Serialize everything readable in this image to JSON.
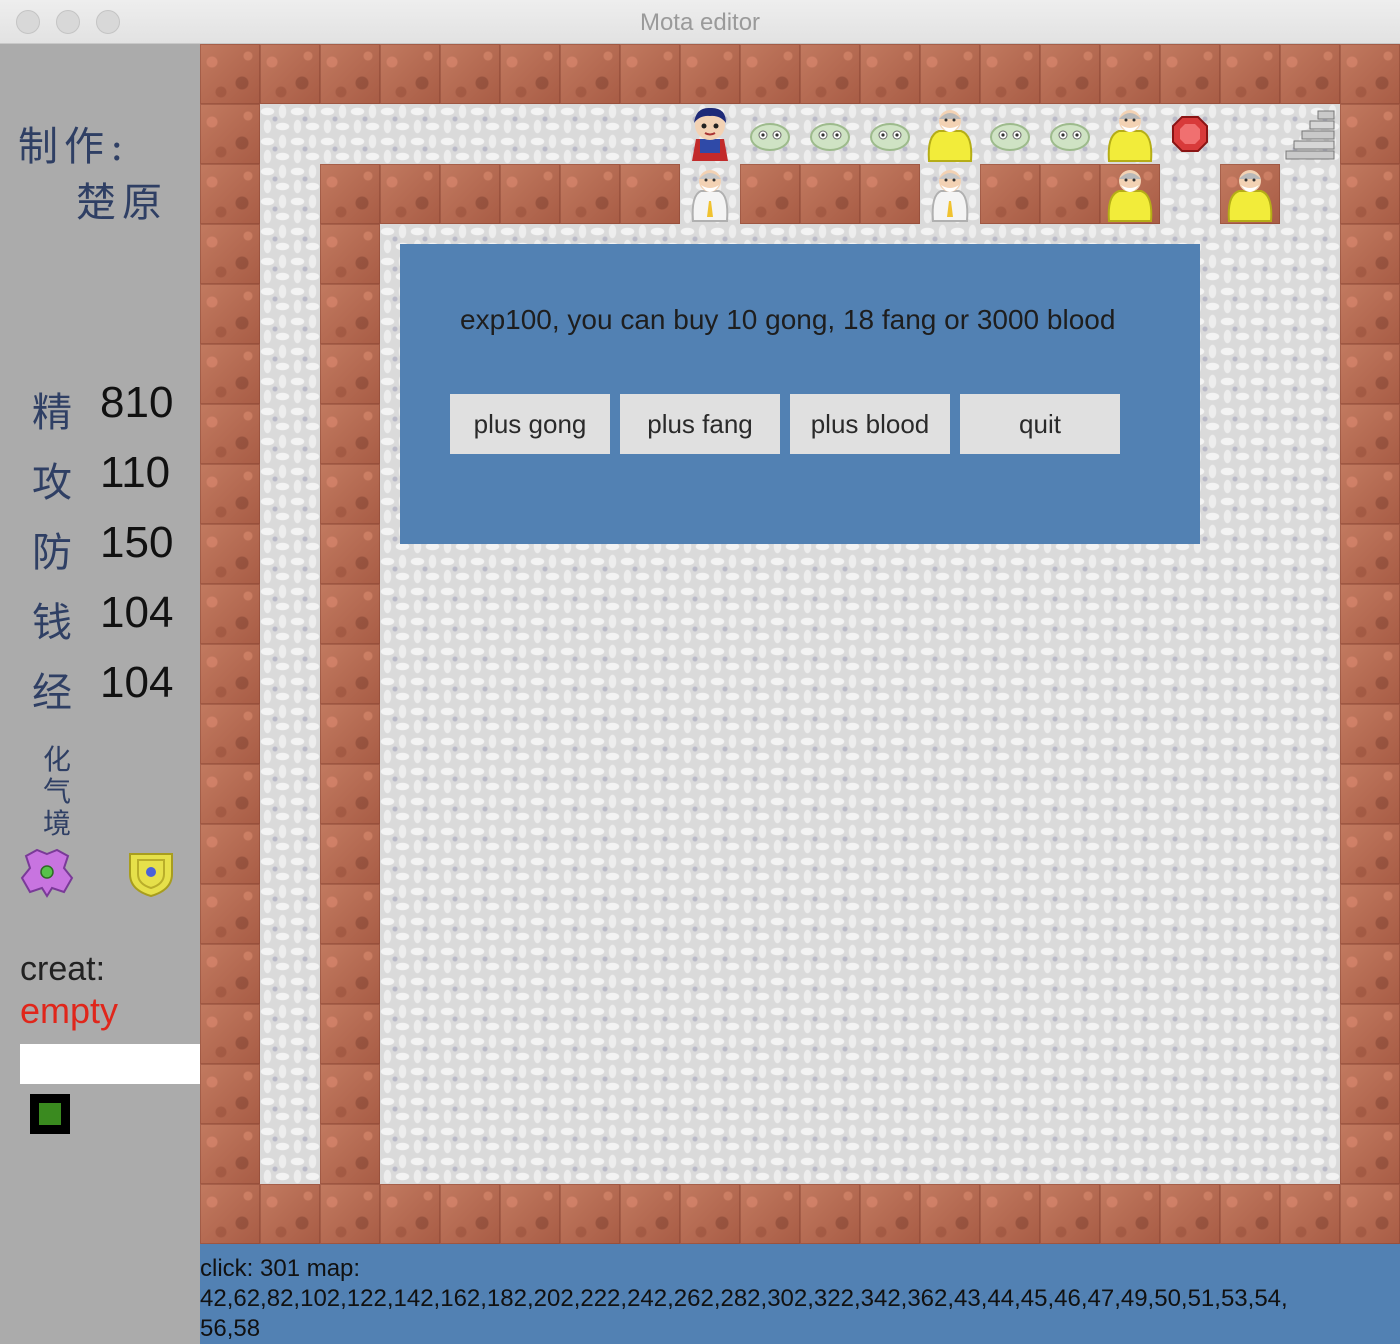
{
  "window": {
    "title": "Mota editor"
  },
  "sidebar": {
    "credit_line1": "制作:",
    "credit_line2": "楚原",
    "stats": [
      {
        "label": "精",
        "value": "810"
      },
      {
        "label": "攻",
        "value": "110"
      },
      {
        "label": "防",
        "value": "150"
      },
      {
        "label": "钱",
        "value": "104"
      },
      {
        "label": "经",
        "value": "104"
      }
    ],
    "realm": [
      "化",
      "气",
      "境"
    ],
    "items": [
      {
        "icon": "purple-cross-gem-icon",
        "color": "#c874e0"
      },
      {
        "icon": "yellow-shield-icon",
        "color": "#e6e04a"
      }
    ],
    "creat_label": "creat:",
    "creat_value": "empty",
    "creat_input_value": "",
    "swatch_color": "#3a8a1f"
  },
  "dialog": {
    "message": "exp100, you can buy 10 gong, 18 fang or 3000 blood",
    "buttons": [
      "plus gong",
      "plus fang",
      "plus blood",
      "quit"
    ]
  },
  "map": {
    "sprites": [
      {
        "type": "hero",
        "icon": "hero-icon"
      },
      {
        "type": "slime",
        "icon": "green-slime-icon"
      },
      {
        "type": "slime",
        "icon": "green-slime-icon"
      },
      {
        "type": "slime",
        "icon": "green-slime-icon"
      },
      {
        "type": "yellow-elder",
        "icon": "yellow-robed-elder-icon"
      },
      {
        "type": "slime",
        "icon": "green-slime-icon"
      },
      {
        "type": "slime",
        "icon": "green-slime-icon"
      },
      {
        "type": "yellow-elder",
        "icon": "yellow-robed-elder-icon"
      },
      {
        "type": "red-gem",
        "icon": "red-gem-icon"
      },
      {
        "type": "stairs",
        "icon": "stairs-up-icon"
      },
      {
        "type": "white-elder",
        "icon": "white-robed-elder-icon"
      },
      {
        "type": "white-elder",
        "icon": "white-robed-elder-icon"
      },
      {
        "type": "yellow-elder",
        "icon": "yellow-robed-elder-icon"
      },
      {
        "type": "yellow-elder",
        "icon": "yellow-robed-elder-icon"
      }
    ]
  },
  "status": {
    "line1": "click: 301 map:",
    "line2": "42,62,82,102,122,142,162,182,202,222,242,262,282,302,322,342,362,43,44,45,46,47,49,50,51,53,54,",
    "line3": "56,58"
  }
}
